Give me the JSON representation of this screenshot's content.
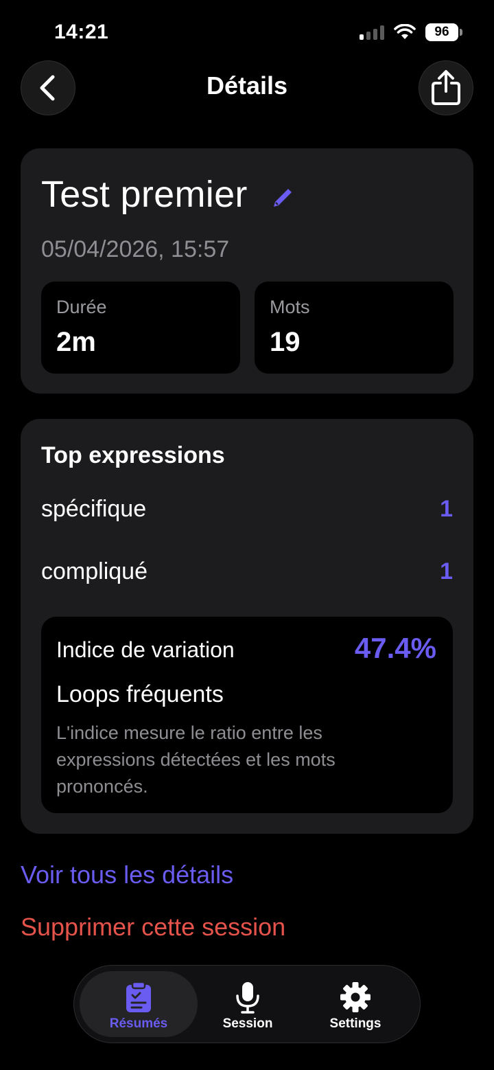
{
  "status_bar": {
    "time": "14:21",
    "battery": "96"
  },
  "nav": {
    "title": "Détails"
  },
  "session": {
    "title": "Test premier",
    "date": "05/04/2026, 15:57",
    "stats": [
      {
        "label": "Durée",
        "value": "2m"
      },
      {
        "label": "Mots",
        "value": "19"
      }
    ]
  },
  "expressions": {
    "heading": "Top expressions",
    "items": [
      {
        "word": "spécifique",
        "count": "1"
      },
      {
        "word": "compliqué",
        "count": "1"
      }
    ],
    "variation": {
      "label": "Indice de variation",
      "value": "47.4%",
      "subtitle": "Loops fréquents",
      "description": "L'indice mesure le ratio entre les expressions détectées et les mots prononcés."
    }
  },
  "links": {
    "details": "Voir tous les détails",
    "delete": "Supprimer cette session"
  },
  "tab_bar": {
    "tabs": [
      {
        "label": "Résumés",
        "icon": "clipboard-check-icon",
        "active": true
      },
      {
        "label": "Session",
        "icon": "microphone-icon",
        "active": false
      },
      {
        "label": "Settings",
        "icon": "gear-icon",
        "active": false
      }
    ]
  },
  "colors": {
    "accent": "#6a5cf0",
    "danger": "#e5534b",
    "card": "#1c1c1e",
    "muted": "#8e8e93"
  }
}
